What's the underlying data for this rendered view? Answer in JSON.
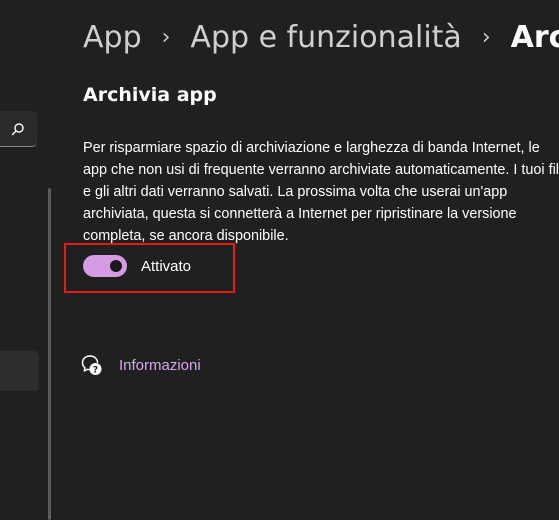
{
  "breadcrumb": {
    "items": [
      "App",
      "App e funzionalità"
    ],
    "current": "Archivia app",
    "separator": "›"
  },
  "section": {
    "title": "Archivia app",
    "description_lines": [
      "Per risparmiare spazio di archiviazione e larghezza di banda Internet, le",
      "app che non usi di frequente verranno archiviate automaticamente. I tuoi file",
      "e gli altri dati verranno salvati. La prossima volta che userai un'app",
      "archiviata, questa si connetterà a Internet per ripristinare la versione",
      "completa, se ancora disponibile."
    ]
  },
  "toggle": {
    "state": "on",
    "label": "Attivato",
    "accent_color": "#d59be3"
  },
  "info": {
    "icon": "help-chat-icon",
    "label": "Informazioni",
    "link_color": "#d9a6ec"
  },
  "sidebar": {
    "search_icon": "search-icon"
  },
  "annotation": {
    "highlight_color": "#e21a1a"
  }
}
